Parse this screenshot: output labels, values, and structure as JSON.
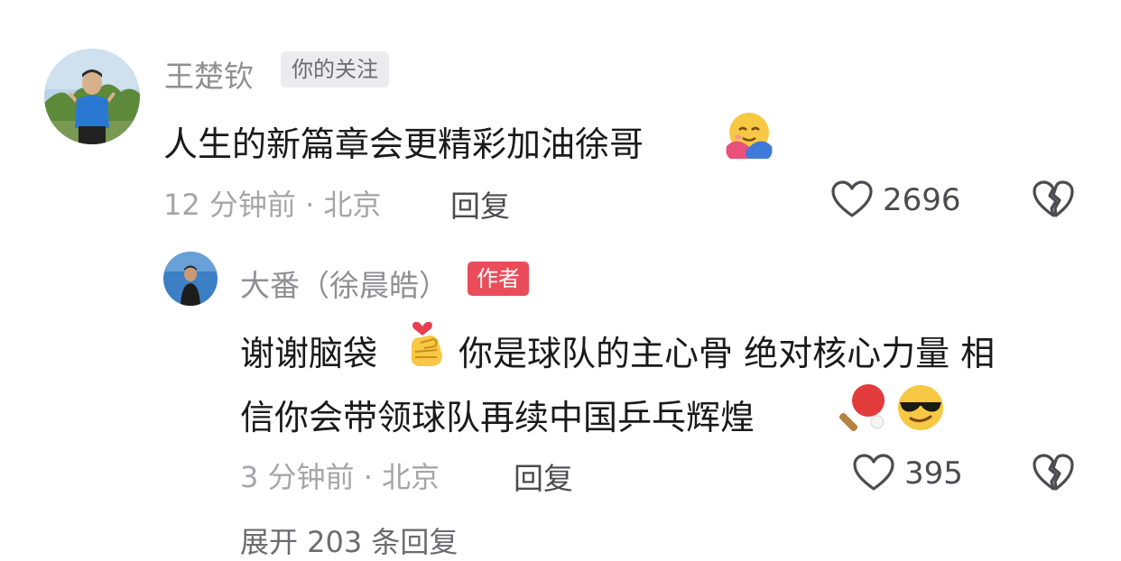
{
  "comments": [
    {
      "username": "王楚钦",
      "badge": "你的关注",
      "text": "人生的新篇章会更精彩加油徐哥",
      "emoji_icon": "hugging-face-icon",
      "meta": "12 分钟前 · 北京",
      "reply_label": "回复",
      "likes": "2696"
    }
  ],
  "reply": {
    "username": "大番（徐晨皓）",
    "badge": "作者",
    "text_line1_part1": "谢谢脑袋",
    "text_line1_part2": "你是球队的主心骨 绝对核心力量 相",
    "text_line2": "信你会带领球队再续中国乒乓辉煌",
    "emoji_icons": [
      "finger-heart-icon",
      "ping-pong-icon",
      "sunglasses-face-icon"
    ],
    "meta": "3 分钟前 · 北京",
    "reply_label": "回复",
    "likes": "395"
  },
  "more_replies": "展开 203 条回复",
  "colors": {
    "author_badge": "#ea4c5a",
    "follow_badge": "#ececef"
  }
}
